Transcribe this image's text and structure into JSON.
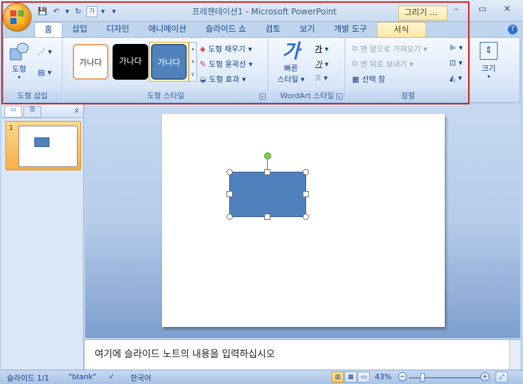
{
  "window": {
    "title": "프레젠테이션1 - Microsoft PowerPoint",
    "context_tab_group": "그리기 ..."
  },
  "quick_access": {
    "customize": "▾"
  },
  "tabs": [
    {
      "label": "홈"
    },
    {
      "label": "삽입"
    },
    {
      "label": "디자인"
    },
    {
      "label": "애니메이션"
    },
    {
      "label": "슬라이드 쇼"
    },
    {
      "label": "검토"
    },
    {
      "label": "보기"
    },
    {
      "label": "개발 도구"
    },
    {
      "label": "서식"
    }
  ],
  "ribbon": {
    "insert_shapes": {
      "label": "도형 삽입",
      "shapes_button": "도형"
    },
    "shape_styles": {
      "label": "도형 스타일",
      "swatch_text": "가나다",
      "fill": "도형 채우기",
      "outline": "도형 윤곽선",
      "effects": "도형 효과"
    },
    "wordart": {
      "label": "WordArt 스타일",
      "quick_styles_line1": "빠른",
      "quick_styles_line2": "스타일",
      "glyph": "가",
      "text_fill_glyph": "가",
      "text_outline_glyph": "가"
    },
    "arrange": {
      "label": "정렬",
      "bring_front": "맨 앞으로 가져오기",
      "send_back": "맨 뒤로 보내기",
      "selection_pane": "선택 창"
    },
    "size": {
      "label": "크기"
    }
  },
  "slides_pane": {
    "slide_number": "1",
    "close": "x"
  },
  "notes": {
    "placeholder": "여기에 슬라이드 노트의 내용을 입력하십시오"
  },
  "status": {
    "slide_info": "슬라이드 1/1",
    "theme": "\"blank\"",
    "language": "한국어",
    "zoom": "43%"
  },
  "colors": {
    "accent_shape": "#4f81bd",
    "highlight": "#d02020"
  }
}
